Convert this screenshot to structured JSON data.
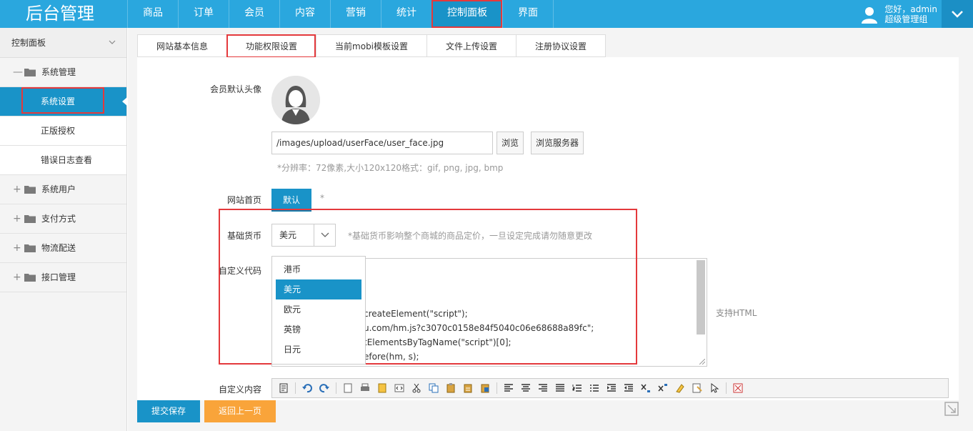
{
  "app": {
    "title": "后台管理"
  },
  "nav": {
    "items": [
      "商品",
      "订单",
      "会员",
      "内容",
      "营销",
      "统计",
      "控制面板",
      "界面"
    ],
    "active_index": 6
  },
  "user": {
    "greeting": "您好，admin",
    "role": "超级管理组"
  },
  "sidebar": {
    "header": "控制面板",
    "groups": [
      {
        "label": "系统管理",
        "expanded": true,
        "children": [
          "系统设置",
          "正版授权",
          "错误日志查看"
        ]
      },
      {
        "label": "系统用户"
      },
      {
        "label": "支付方式"
      },
      {
        "label": "物流配送"
      },
      {
        "label": "接口管理"
      }
    ],
    "active_child": "系统设置"
  },
  "tabs": [
    "网站基本信息",
    "功能权限设置",
    "当前mobi模板设置",
    "文件上传设置",
    "注册协议设置"
  ],
  "active_tab": 1,
  "form": {
    "avatar_label": "会员默认头像",
    "avatar_path": "/images/upload/userFace/user_face.jpg",
    "browse_label": "浏览",
    "browse_server_label": "浏览服务器",
    "avatar_hint": "*分辨率：72像素,大小120x120格式：gif, png, jpg, bmp",
    "home_label": "网站首页",
    "home_value": "默认",
    "home_star": "*",
    "currency_label": "基础货币",
    "currency_value": "美元",
    "currency_hint": "*基础货币影响整个商城的商品定价，一旦设定完成请勿随意更改",
    "currency_options": [
      "港币",
      "美元",
      "欧元",
      "英镑",
      "日元"
    ],
    "custom_code_label": "自定义代码",
    "custom_code_lines": [
      "createElement(\"script\");",
      "u.com/hm.js?c3070c0158e84f5040c06e68688a89fc\";",
      "tElementsByTagName(\"script\")[0];",
      "efore(hm, s);"
    ],
    "custom_code_hint": "支持HTML",
    "custom_content_label": "自定义内容"
  },
  "footer": {
    "save_label": "提交保存",
    "back_label": "返回上一页"
  },
  "colors": {
    "primary": "#1993c8",
    "topbar": "#2aa7de",
    "accent_orange": "#f9a43a",
    "highlight_red": "#e4393c"
  }
}
